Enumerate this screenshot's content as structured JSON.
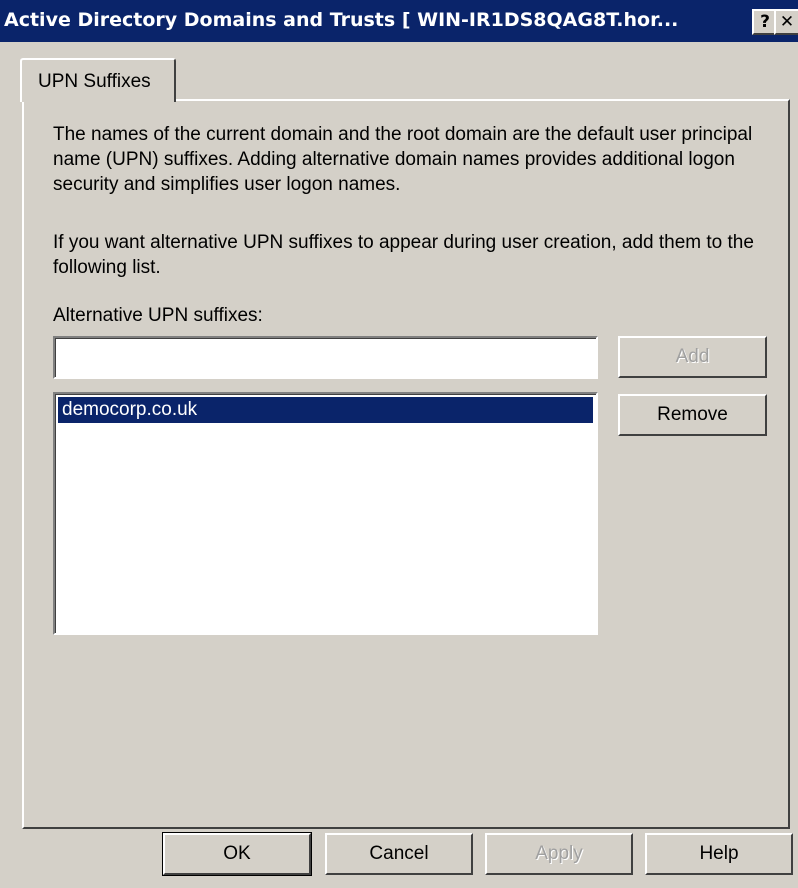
{
  "window": {
    "title": "Active Directory Domains and Trusts [ WIN-IR1DS8QAG8T.hor...",
    "help_button": "?",
    "close_button": "✕"
  },
  "tabs": [
    {
      "label": "UPN Suffixes",
      "selected": true
    }
  ],
  "content": {
    "description": "The names of the current domain and the root domain are the default user principal name (UPN) suffixes. Adding alternative domain names provides additional logon security and simplifies user logon names.",
    "instruction": "If you want alternative UPN suffixes to appear during user creation, add them to the following list.",
    "suffix_label": "Alternative UPN suffixes:",
    "suffix_input_value": "",
    "add_button": "Add",
    "remove_button": "Remove",
    "suffixes": [
      {
        "name": "democorp.co.uk",
        "selected": true
      }
    ]
  },
  "footer": {
    "ok": "OK",
    "cancel": "Cancel",
    "apply": "Apply",
    "help": "Help"
  },
  "colors": {
    "titlebar": "#0a246a",
    "face": "#d4d0c8",
    "selection": "#0a246a"
  }
}
